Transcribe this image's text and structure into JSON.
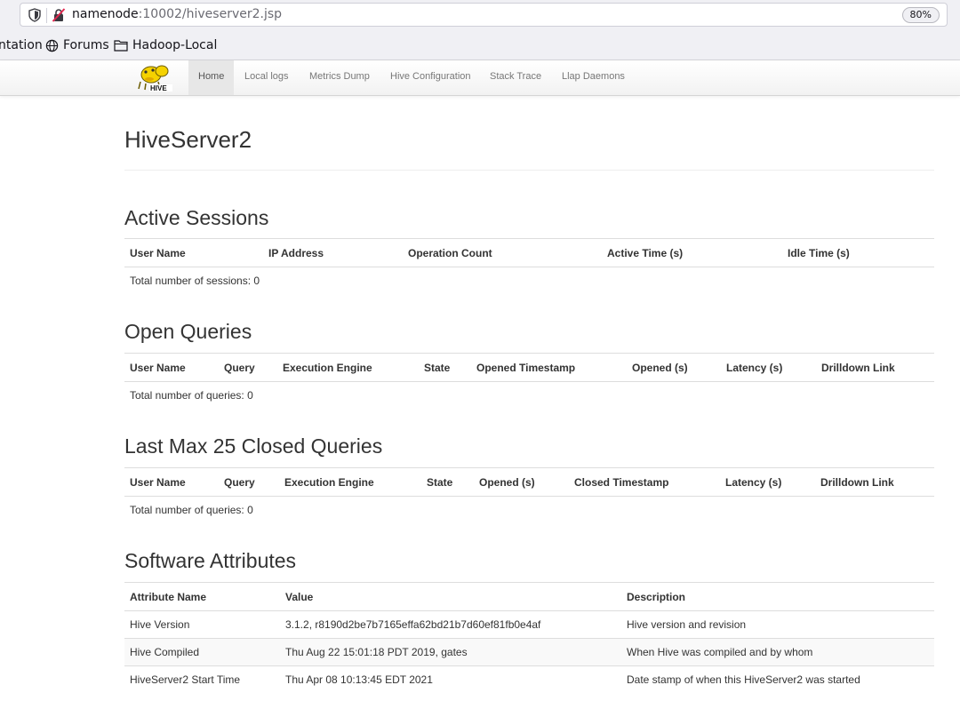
{
  "browser": {
    "url_host": "namenode",
    "url_path": ":10002/hiveserver2.jsp",
    "zoom": "80%",
    "bookmarks": [
      {
        "label": "ntation"
      },
      {
        "label": "Forums"
      },
      {
        "label": "Hadoop-Local"
      }
    ]
  },
  "nav": {
    "logo_text": "HIVE",
    "links": [
      "Home",
      "Local logs",
      "Metrics Dump",
      "Hive Configuration",
      "Stack Trace",
      "Llap Daemons"
    ]
  },
  "page": {
    "title": "HiveServer2"
  },
  "active_sessions": {
    "title": "Active Sessions",
    "columns": [
      "User Name",
      "IP Address",
      "Operation Count",
      "Active Time (s)",
      "Idle Time (s)"
    ],
    "summary": "Total number of sessions: 0"
  },
  "open_queries": {
    "title": "Open Queries",
    "columns": [
      "User Name",
      "Query",
      "Execution Engine",
      "State",
      "Opened Timestamp",
      "Opened (s)",
      "Latency (s)",
      "Drilldown Link"
    ],
    "summary": "Total number of queries: 0"
  },
  "closed_queries": {
    "title": "Last Max 25 Closed Queries",
    "columns": [
      "User Name",
      "Query",
      "Execution Engine",
      "State",
      "Opened (s)",
      "Closed Timestamp",
      "Latency (s)",
      "Drilldown Link"
    ],
    "summary": "Total number of queries: 0"
  },
  "software_attributes": {
    "title": "Software Attributes",
    "columns": [
      "Attribute Name",
      "Value",
      "Description"
    ],
    "rows": [
      [
        "Hive Version",
        "3.1.2, r8190d2be7b7165effa62bd21b7d60ef81fb0e4af",
        "Hive version and revision"
      ],
      [
        "Hive Compiled",
        "Thu Aug 22 15:01:18 PDT 2019, gates",
        "When Hive was compiled and by whom"
      ],
      [
        "HiveServer2 Start Time",
        "Thu Apr 08 10:13:45 EDT 2021",
        "Date stamp of when this HiveServer2 was started"
      ]
    ]
  }
}
